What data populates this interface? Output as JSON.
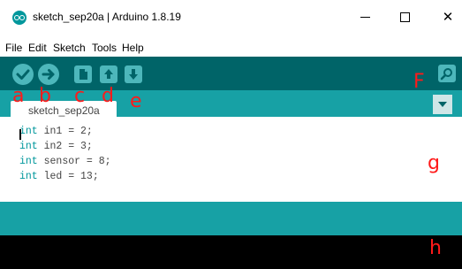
{
  "window": {
    "title": "sketch_sep20a | Arduino 1.8.19",
    "minimize": "—",
    "maximize": "☐",
    "close": "✕"
  },
  "menu": [
    "File",
    "Edit",
    "Sketch",
    "Tools",
    "Help"
  ],
  "toolbar": {
    "buttons": [
      "verify",
      "upload",
      "new",
      "open",
      "save"
    ],
    "serial_monitor": "serial-monitor"
  },
  "tabs": [
    {
      "label": "sketch_sep20a"
    }
  ],
  "code": [
    {
      "kw": "int",
      "rest": " in1 = 2;"
    },
    {
      "kw": "int",
      "rest": " in2 = 3;"
    },
    {
      "kw": "int",
      "rest": " sensor = 8;"
    },
    {
      "kw": "int",
      "rest": " led = 13;"
    }
  ],
  "annotations": {
    "a": "a",
    "b": "b",
    "c": "c",
    "d": "d",
    "e": "e",
    "f": "F",
    "g": "g",
    "h": "h"
  },
  "colors": {
    "toolbar": "#006468",
    "tabbar": "#17a1a5",
    "buttons": "#4db7bb",
    "console": "#000000",
    "annotation": "#ff1a1a"
  }
}
